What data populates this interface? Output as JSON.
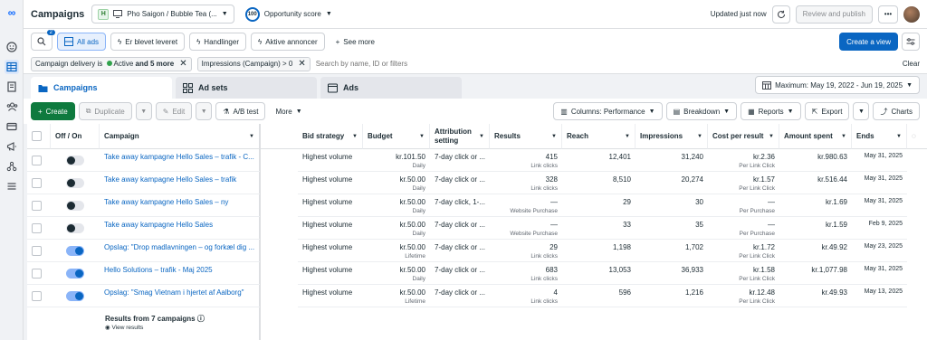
{
  "header": {
    "title": "Campaigns",
    "account_initial": "H",
    "account_name": "Pho Saigon / Bubble Tea (...",
    "opportunity_value": "100",
    "opportunity_label": "Opportunity score",
    "updated": "Updated just now",
    "review_publish": "Review and publish"
  },
  "search_badge": "2",
  "quick_filters": [
    "All ads",
    "Er blevet leveret",
    "Handlinger",
    "Aktive annoncer"
  ],
  "see_more": "See more",
  "create_view": "Create a view",
  "filters": {
    "chip1_prefix": "Campaign delivery is",
    "chip1_status": "Active",
    "chip1_suffix": "and 5 more",
    "chip2": "Impressions (Campaign) > 0",
    "search_placeholder": "Search by name, ID or filters",
    "clear": "Clear"
  },
  "tabs": [
    "Campaigns",
    "Ad sets",
    "Ads"
  ],
  "date_range": "Maximum: May 19, 2022 - Jun 19, 2025",
  "toolbar": {
    "create": "Create",
    "duplicate": "Duplicate",
    "edit": "Edit",
    "ab_test": "A/B test",
    "more": "More",
    "columns": "Columns: Performance",
    "breakdown": "Breakdown",
    "reports": "Reports",
    "export": "Export",
    "charts": "Charts"
  },
  "columns": {
    "offon": "Off / On",
    "campaign": "Campaign",
    "bid": "Bid strategy",
    "budget": "Budget",
    "attribution": "Attribution setting",
    "results": "Results",
    "reach": "Reach",
    "impressions": "Impressions",
    "cpr": "Cost per result",
    "spent": "Amount spent",
    "ends": "Ends"
  },
  "rows": [
    {
      "on": false,
      "campaign": "Take away kampagne Hello Sales – trafik - C...",
      "bid": "Highest volume",
      "budget": "kr.101.50",
      "budget_type": "Daily",
      "attribution": "7-day click or ...",
      "results": "415",
      "results_type": "Link clicks",
      "reach": "12,401",
      "impressions": "31,240",
      "cpr": "kr.2.36",
      "cpr_type": "Per Link Click",
      "spent": "kr.980.63",
      "ends": "May 31, 2025"
    },
    {
      "on": false,
      "campaign": "Take away kampagne Hello Sales – trafik",
      "bid": "Highest volume",
      "budget": "kr.50.00",
      "budget_type": "Daily",
      "attribution": "7-day click or ...",
      "results": "328",
      "results_type": "Link clicks",
      "reach": "8,510",
      "impressions": "20,274",
      "cpr": "kr.1.57",
      "cpr_type": "Per Link Click",
      "spent": "kr.516.44",
      "ends": "May 31, 2025"
    },
    {
      "on": false,
      "campaign": "Take away kampagne Hello Sales – ny",
      "bid": "Highest volume",
      "budget": "kr.50.00",
      "budget_type": "Daily",
      "attribution": "7-day click, 1-...",
      "results": "—",
      "results_type": "Website Purchase",
      "reach": "29",
      "impressions": "30",
      "cpr": "—",
      "cpr_type": "Per Purchase",
      "spent": "kr.1.69",
      "ends": "May 31, 2025"
    },
    {
      "on": false,
      "campaign": "Take away kampagne Hello Sales",
      "bid": "Highest volume",
      "budget": "kr.50.00",
      "budget_type": "Daily",
      "attribution": "7-day click or ...",
      "results": "—",
      "results_type": "Website Purchase",
      "reach": "33",
      "impressions": "35",
      "cpr": "—",
      "cpr_type": "Per Purchase",
      "spent": "kr.1.59",
      "ends": "Feb 9, 2025"
    },
    {
      "on": true,
      "campaign": "Opslag: \"Drop madlavningen – og forkæl dig ...",
      "bid": "Highest volume",
      "budget": "kr.50.00",
      "budget_type": "Lifetime",
      "attribution": "7-day click or ...",
      "results": "29",
      "results_type": "Link clicks",
      "reach": "1,198",
      "impressions": "1,702",
      "cpr": "kr.1.72",
      "cpr_type": "Per Link Click",
      "spent": "kr.49.92",
      "ends": "May 23, 2025"
    },
    {
      "on": true,
      "campaign": "Hello Solutions – trafik - Maj 2025",
      "bid": "Highest volume",
      "budget": "kr.50.00",
      "budget_type": "Daily",
      "attribution": "7-day click or ...",
      "results": "683",
      "results_type": "Link clicks",
      "reach": "13,053",
      "impressions": "36,933",
      "cpr": "kr.1.58",
      "cpr_type": "Per Link Click",
      "spent": "kr.1,077.98",
      "ends": "May 31, 2025"
    },
    {
      "on": true,
      "campaign": "Opslag: \"Smag Vietnam i hjertet af Aalborg\"",
      "bid": "Highest volume",
      "budget": "kr.50.00",
      "budget_type": "Lifetime",
      "attribution": "7-day click or ...",
      "results": "4",
      "results_type": "Link clicks",
      "reach": "596",
      "impressions": "1,216",
      "cpr": "kr.12.48",
      "cpr_type": "Per Link Click",
      "spent": "kr.49.93",
      "ends": "May 13, 2025"
    }
  ],
  "footer": {
    "results_label": "Results from 7 campaigns",
    "view_results": "View results"
  }
}
